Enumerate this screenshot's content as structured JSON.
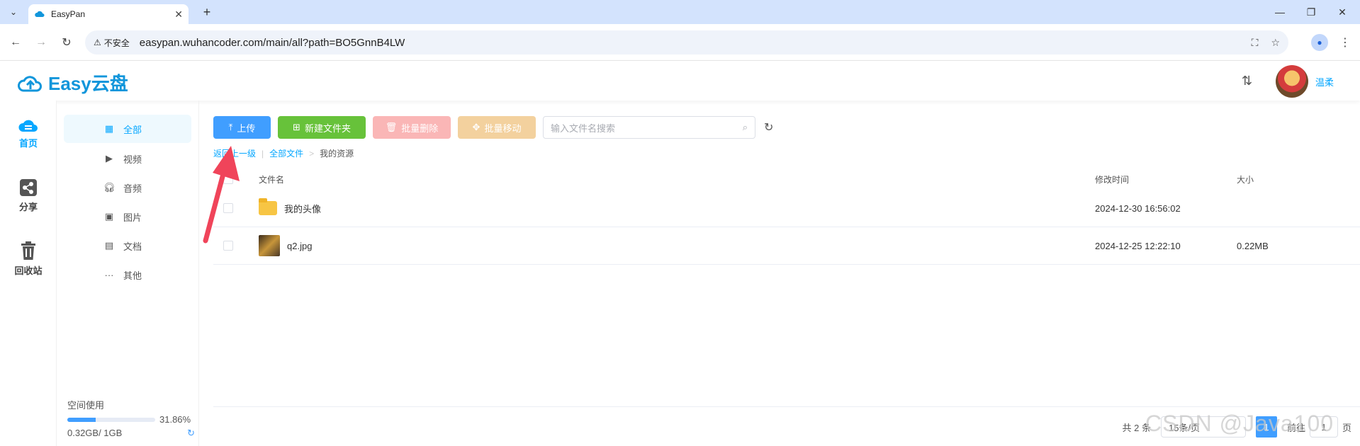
{
  "browser": {
    "tab_title": "EasyPan",
    "security_label": "不安全",
    "url": "easypan.wuhancoder.com/main/all?path=BO5GnnB4LW"
  },
  "app": {
    "logo_text": "Easy云盘",
    "username": "温柔",
    "brand_color": "#1296db"
  },
  "left_nav": [
    {
      "label": "首页",
      "icon": "cloud-home-icon",
      "active": true
    },
    {
      "label": "分享",
      "icon": "share-icon",
      "active": false
    },
    {
      "label": "回收站",
      "icon": "trash-icon",
      "active": false
    }
  ],
  "sub_nav": [
    {
      "label": "全部",
      "icon": "grid-icon",
      "active": true
    },
    {
      "label": "视频",
      "icon": "play-icon",
      "active": false
    },
    {
      "label": "音频",
      "icon": "headphones-icon",
      "active": false
    },
    {
      "label": "图片",
      "icon": "image-icon",
      "active": false
    },
    {
      "label": "文档",
      "icon": "document-icon",
      "active": false
    },
    {
      "label": "其他",
      "icon": "more-icon",
      "active": false
    }
  ],
  "space": {
    "label": "空间使用",
    "percent": "31.86%",
    "fraction": 0.3186,
    "used_text": "0.32GB/ 1GB"
  },
  "toolbar": {
    "upload": "上传",
    "new_folder": "新建文件夹",
    "batch_delete": "批量删除",
    "batch_move": "批量移动",
    "search_placeholder": "输入文件名搜索"
  },
  "breadcrumb": {
    "back": "返回上一级",
    "all_files": "全部文件",
    "current": "我的资源"
  },
  "table": {
    "headers": {
      "name": "文件名",
      "time": "修改时间",
      "size": "大小"
    },
    "rows": [
      {
        "name": "我的头像",
        "time": "2024-12-30 16:56:02",
        "size": "",
        "type": "folder"
      },
      {
        "name": "q2.jpg",
        "time": "2024-12-25 12:22:10",
        "size": "0.22MB",
        "type": "image"
      }
    ]
  },
  "pager": {
    "total": "共 2 条",
    "page_size": "15条/页",
    "current_page": "1",
    "goto_label": "前往",
    "goto_value": "1",
    "goto_suffix": "页"
  },
  "watermark": "CSDN @Java100"
}
